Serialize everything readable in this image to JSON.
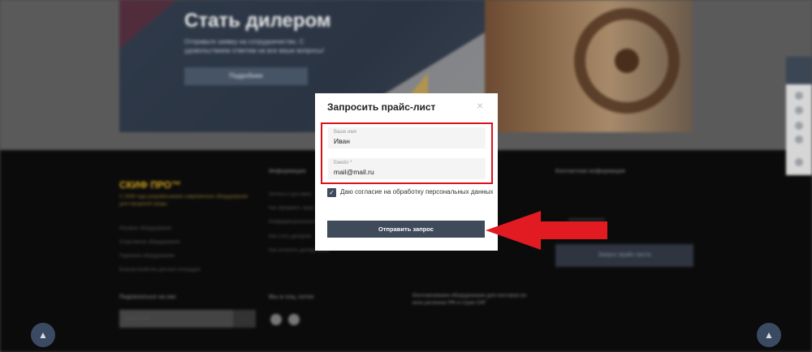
{
  "banner": {
    "title": "Стать дилером",
    "subtitle": "Отправьте заявку на сотрудничество. С удовольствием ответим на все ваши вопросы!",
    "button_label": "Подробнее"
  },
  "footer": {
    "brand": "СКИФ ПРО™",
    "brand_desc": "С 2006 года разрабатываем современное оборудование для городской среды",
    "col1_links": [
      "Игровое оборудование",
      "Спортивное оборудование",
      "Парковое оборудование",
      "Благоустройство детских площадок"
    ],
    "col2_head": "Информация",
    "col2_links": [
      "Оплата и доставка",
      "Как оформить заказ",
      "Конфиденциальность",
      "Как стать дилером",
      "Как оплатить дилеру заказ"
    ],
    "col4_head": "Контактная информация",
    "col4_button": "Запрос прайс-листа",
    "subscribe_head": "Подписаться на нас",
    "subscribe_placeholder": "Ваш e-mail",
    "social_head": "Мы в соц. сетях",
    "regions_text": "Изготавливаем оборудование для поставок во всех регионах РФ и стран СНГ"
  },
  "modal": {
    "title": "Запросить прайс-лист",
    "close_symbol": "×",
    "name_label": "Ваше имя",
    "name_value": "Иван",
    "email_label": "Емейл *",
    "email_value": "mail@mail.ru",
    "consent_checked": true,
    "consent_text": "Даю согласие на обработку персональных данных",
    "submit_label": "Отправить запрос"
  },
  "colors": {
    "accent_dark": "#3f4a5a",
    "highlight_red": "#d7141a",
    "arrow_red": "#e21b22"
  },
  "icons": {
    "scroll_up": "▲",
    "check": "✓"
  }
}
